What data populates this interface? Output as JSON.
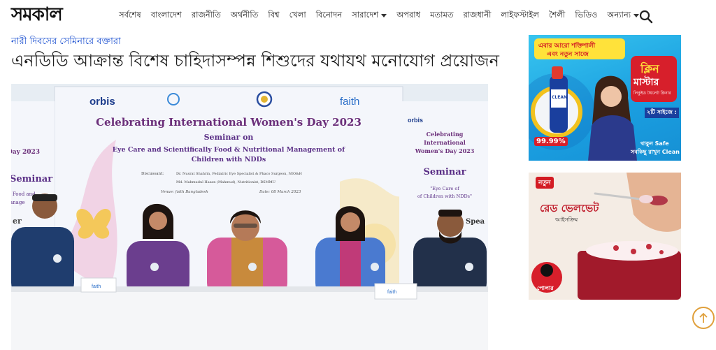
{
  "site": {
    "logo": "সমকাল"
  },
  "nav": {
    "items": [
      {
        "label": "সর্বশেষ",
        "dropdown": false
      },
      {
        "label": "বাংলাদেশ",
        "dropdown": false
      },
      {
        "label": "রাজনীতি",
        "dropdown": false
      },
      {
        "label": "অর্থনীতি",
        "dropdown": false
      },
      {
        "label": "বিশ্ব",
        "dropdown": false
      },
      {
        "label": "খেলা",
        "dropdown": false
      },
      {
        "label": "বিনোদন",
        "dropdown": false
      },
      {
        "label": "সারাদেশ",
        "dropdown": true
      },
      {
        "label": "অপরাধ",
        "dropdown": false
      },
      {
        "label": "মতামত",
        "dropdown": false
      },
      {
        "label": "রাজধানী",
        "dropdown": false
      },
      {
        "label": "লাইফস্টাইল",
        "dropdown": false
      },
      {
        "label": "শৈলী",
        "dropdown": false
      },
      {
        "label": "ভিডিও",
        "dropdown": false
      },
      {
        "label": "অন্যান্য",
        "dropdown": true
      }
    ],
    "search_icon": "search-icon"
  },
  "article": {
    "kicker": "নারী দিবসের সেমিনারে বক্তারা",
    "headline": "এনডিডি আক্রান্ত বিশেষ চাহিদাসম্পন্ন শিশুদের যথাযথ মনোযোগ প্রয়োজন"
  },
  "photo": {
    "banner_logos": [
      "orbis",
      "faith"
    ],
    "banner_title": "Celebrating International Women's Day 2023",
    "banner_seminar": "Seminar on",
    "banner_topic_1": "Eye Care and Scientifically Food & Nutritional Management of",
    "banner_topic_2": "Children with NDDs",
    "banner_discussant_label": "Discussant:",
    "banner_discussant_1": "Dr. Nusrat Shahrin, Pediatric Eye Specialist & Phaco Surgeon, NIO&H",
    "banner_discussant_2": "Md. Mahmudul Hasan (Mahmud), Nutritionist, BSMMU",
    "banner_venue": "Venue: faith Bangladesh",
    "banner_date": "Date: 08 March 2023",
    "left_banner_day": "Day 2023",
    "left_banner_seminar": "Seminar",
    "left_banner_food": "s Food and",
    "left_banner_manage": "anage",
    "left_banner_er": "er",
    "right_banner_title_1": "Celebrating",
    "right_banner_title_2": "International",
    "right_banner_title_3": "Women's Day 2023",
    "right_banner_seminar": "Seminar",
    "right_banner_topic_1": "\"Eye Care of",
    "right_banner_topic_2": "of Children with NDDs\"",
    "right_banner_spea": "Spea",
    "desk_logo": "faith"
  },
  "ads": {
    "ad1": {
      "line1": "এবার আরো শক্তিশালী",
      "line2": "এবং নতুন সাজে",
      "brand_1": "ক্লিন",
      "brand_2": "মাস্টার",
      "sub": "লিকুইড টয়লেট ক্লিনার",
      "sizes": "২টি সাইজে :",
      "percent": "99.99%",
      "tagline_1": "থাকুন Safe",
      "tagline_2": "সবকিছু রাখুন Clean",
      "bottle_label": "CLEAN"
    },
    "ad2": {
      "new_label": "নতুন",
      "product": "রেড ভেলভেট",
      "type": "আইসক্রিম",
      "brand": "পোলার"
    }
  },
  "scroll_top_icon": "arrow-up-icon"
}
